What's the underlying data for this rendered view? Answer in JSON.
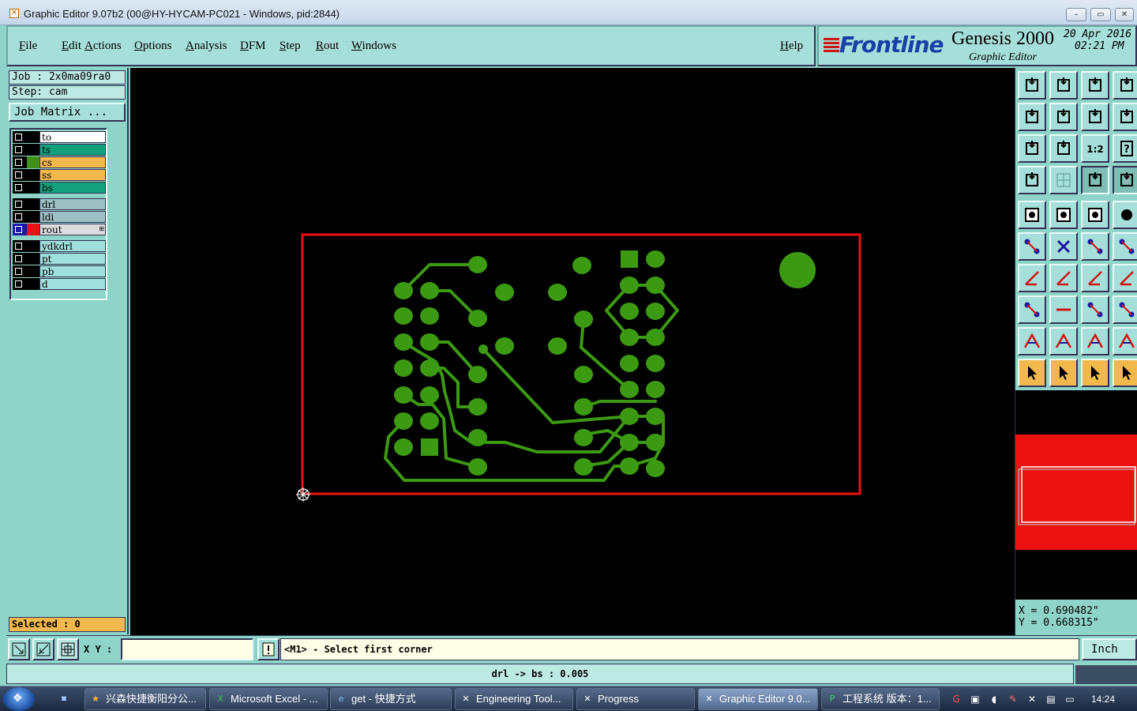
{
  "window": {
    "title": "Graphic Editor 9.07b2 (00@HY-HYCAM-PC021 - Windows, pid:2844)"
  },
  "menu": {
    "items": [
      "File",
      "Edit",
      "Actions",
      "Options",
      "Analysis",
      "DFM",
      "Step",
      "Rout",
      "Windows"
    ],
    "help": "Help"
  },
  "logo": {
    "brand": "Frontline",
    "product": "Genesis 2000",
    "subtitle": "Graphic Editor",
    "date": "20 Apr 2016",
    "time": "02:21 PM"
  },
  "job": {
    "job_label": "Job : 2x0ma09ra0",
    "step_label": "Step: cam",
    "matrix_button": "Job Matrix ..."
  },
  "layers": [
    {
      "name": "to",
      "color": "#ffffff",
      "swatch": "#000000",
      "active": false
    },
    {
      "name": "ts",
      "color": "#14a07c",
      "swatch": "#000000",
      "active": false
    },
    {
      "name": "cs",
      "color": "#f2b84c",
      "swatch": "#3f8f18",
      "active": false
    },
    {
      "name": "ss",
      "color": "#f2b84c",
      "swatch": "#000000",
      "active": false
    },
    {
      "name": "bs",
      "color": "#14a07c",
      "swatch": "#000000",
      "active": false
    },
    {
      "name": "drl",
      "color": "#9ec0c4",
      "swatch": "#000000",
      "active": false
    },
    {
      "name": "ldi",
      "color": "#9ec0c4",
      "swatch": "#000000",
      "active": false
    },
    {
      "name": "rout",
      "color": "#dcdcdc",
      "swatch": "#ee1111",
      "active": true
    },
    {
      "name": "ydkdrl",
      "color": "#9fe0dc",
      "swatch": "#000000",
      "active": false
    },
    {
      "name": "pt",
      "color": "#9fe0dc",
      "swatch": "#000000",
      "active": false
    },
    {
      "name": "pb",
      "color": "#9fe0dc",
      "swatch": "#000000",
      "active": false
    },
    {
      "name": "d",
      "color": "#9fe0dc",
      "swatch": "#000000",
      "active": false
    }
  ],
  "selected": "Selected : 0",
  "coords": {
    "x": "X = 0.690482\"",
    "y": "Y = 0.668315\""
  },
  "command": {
    "xy_label": "X Y :",
    "xy_value": "",
    "message": "<M1> - Select first corner",
    "units": "Inch"
  },
  "status": "drl -> bs : 0.005",
  "colors": {
    "trace": "#3c9a12",
    "profile": "#ee1111",
    "background": "#000000",
    "panel": "#8fd4c8"
  },
  "taskbar": {
    "items": [
      {
        "label": "兴森快捷衡阳分公...",
        "icon": "star-icon",
        "active": false
      },
      {
        "label": "Microsoft Excel - ...",
        "icon": "excel-icon",
        "active": false
      },
      {
        "label": "get - 快捷方式",
        "icon": "ie-icon",
        "active": false
      },
      {
        "label": "Engineering Tool...",
        "icon": "app-icon",
        "active": false
      },
      {
        "label": "Progress",
        "icon": "app-icon",
        "active": false
      },
      {
        "label": "Graphic Editor 9.0...",
        "icon": "app-icon",
        "active": true
      },
      {
        "label": "工程系统   版本：1...",
        "icon": "p-icon",
        "active": false
      }
    ],
    "clock": "14:24"
  }
}
